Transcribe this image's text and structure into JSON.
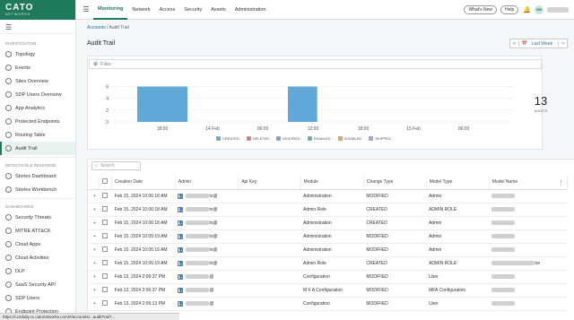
{
  "logo": {
    "brand": "CATO",
    "sub": "NETWORKS"
  },
  "sidebar": {
    "sections": [
      {
        "title": "INVESTIGATION",
        "items": [
          {
            "label": "Topology"
          },
          {
            "label": "Events"
          },
          {
            "label": "Sites Overview"
          },
          {
            "label": "SDP Users Overview"
          },
          {
            "label": "App Analytics"
          },
          {
            "label": "Protected Endpoints"
          },
          {
            "label": "Routing Table"
          },
          {
            "label": "Audit Trail",
            "active": true
          }
        ]
      },
      {
        "title": "DETECTION & RESPONSE",
        "items": [
          {
            "label": "Stories Dashboard"
          },
          {
            "label": "Stories Workbench"
          }
        ]
      },
      {
        "title": "DASHBOARDS",
        "items": [
          {
            "label": "Security Threats"
          },
          {
            "label": "MITRE ATT&CK"
          },
          {
            "label": "Cloud Apps"
          },
          {
            "label": "Cloud Activities"
          },
          {
            "label": "DLP"
          },
          {
            "label": "SaaS Security API"
          },
          {
            "label": "SDP Users"
          },
          {
            "label": "Endpoint Protection"
          }
        ]
      }
    ]
  },
  "topbar": {
    "menu": [
      "Monitoring",
      "Network",
      "Access",
      "Security",
      "Assets",
      "Administration"
    ],
    "active": "Monitoring",
    "whats_new": "What's New",
    "help": "Help",
    "avatar": "SM"
  },
  "breadcrumb": {
    "root": "Accounts",
    "sep": "/",
    "current": "Audit Trail"
  },
  "page_title": "Audit Trail",
  "range": {
    "prev": "<",
    "label": "Last Week",
    "next": ">"
  },
  "filter_label": "Filter",
  "chart_data": {
    "type": "bar",
    "y_ticks": [
      0,
      2,
      4,
      6
    ],
    "ylim": [
      0,
      7
    ],
    "x_tick_labels": [
      "18:00",
      "14 Feb",
      "06:00",
      "12:00",
      "18:00",
      "15 Feb",
      "06:00"
    ],
    "bars": [
      {
        "start": "14 Feb 15:00",
        "end": "14 Feb 21:00",
        "value": 6
      },
      {
        "start": "15 Feb 09:00",
        "end": "15 Feb 12:30",
        "value": 6
      }
    ],
    "bar_color": "#5fa8d8"
  },
  "total": {
    "count": "13",
    "label": "AUDITS"
  },
  "legend": [
    {
      "label": "CREATED",
      "color": "#5fa8d8"
    },
    {
      "label": "DELETED",
      "color": "#e86b6b"
    },
    {
      "label": "MODIFIED",
      "color": "#5fa8d8"
    },
    {
      "label": "ENABLED",
      "color": "#4cb38a"
    },
    {
      "label": "DISABLED",
      "color": "#f0a640"
    },
    {
      "label": "SKIPPED",
      "color": "#b6a0d8"
    }
  ],
  "search_placeholder": "Search",
  "table": {
    "columns": [
      "Creation Date",
      "Admin",
      "Api Key",
      "Module",
      "Change Type",
      "Model Type",
      "Model Name"
    ],
    "rows": [
      {
        "date": "Feb 15, 2024 10:06:18 AM",
        "admin": "to@",
        "module": "Administration",
        "change": "MODIFIED",
        "model_type": "Admin"
      },
      {
        "date": "Feb 15, 2024 10:06:18 AM",
        "admin": "to@",
        "module": "Admin Role",
        "change": "CREATED",
        "model_type": "ADMIN ROLE"
      },
      {
        "date": "Feb 15, 2024 10:06:18 AM",
        "admin": "to@",
        "module": "Administration",
        "change": "CREATED",
        "model_type": "Admin"
      },
      {
        "date": "Feb 15, 2024 10:05:19 AM",
        "admin": "to@",
        "module": "Administration",
        "change": "MODIFIED",
        "model_type": "Admin"
      },
      {
        "date": "Feb 15, 2024 10:05:19 AM",
        "admin": "to@",
        "module": "Administration",
        "change": "MODIFIED",
        "model_type": "Admin"
      },
      {
        "date": "Feb 15, 2024 10:05:19 AM",
        "admin": "to@",
        "module": "Admin Role",
        "change": "CREATED",
        "model_type": "ADMIN ROLE",
        "model_name_suffix": "tor"
      },
      {
        "date": "Feb 13, 2024 2:06:37 PM",
        "admin": "@",
        "module": "Configuration",
        "change": "MODIFIED",
        "model_type": "User"
      },
      {
        "date": "Feb 13, 2024 2:06:37 PM",
        "admin": "@",
        "module": "M F A Configuration",
        "change": "MODIFIED",
        "model_type": "MFA Configuration"
      },
      {
        "date": "Feb 13, 2024 2:06:13 PM",
        "admin": "@",
        "module": "Configuration",
        "change": "MODIFIED",
        "model_type": "User"
      }
    ]
  },
  "statusbar": "https://cc2daily.cc.catonetworks.com/#/accounts/...auditTrail?..."
}
